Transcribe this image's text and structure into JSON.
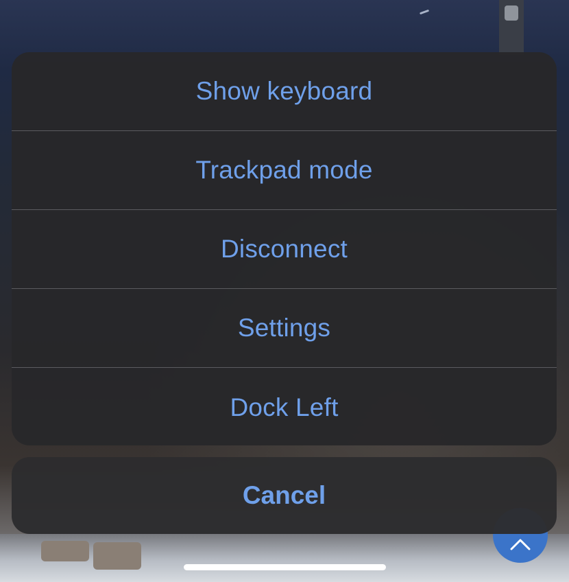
{
  "action_sheet": {
    "items": [
      {
        "label": "Show keyboard"
      },
      {
        "label": "Trackpad mode"
      },
      {
        "label": "Disconnect"
      },
      {
        "label": "Settings"
      },
      {
        "label": "Dock Left"
      }
    ],
    "cancel_label": "Cancel"
  },
  "colors": {
    "action_text": "#6fa0ea",
    "sheet_background": "#28282a",
    "fab_background": "#3b74c9"
  },
  "icons": {
    "fab_icon": "chevron-up-icon"
  }
}
